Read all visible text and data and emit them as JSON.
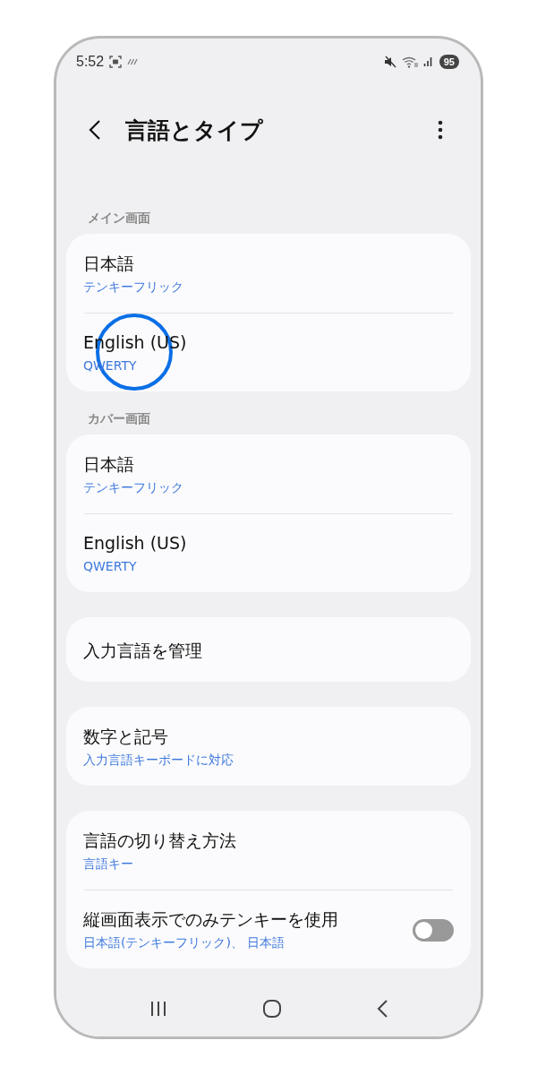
{
  "status_bar": {
    "time": "5:52",
    "battery": "95"
  },
  "header": {
    "title": "言語とタイプ"
  },
  "sections": [
    {
      "header": "メイン画面",
      "items": [
        {
          "kind": "link",
          "title": "日本語",
          "subtitle": "テンキーフリック",
          "touched": false
        },
        {
          "kind": "link",
          "title": "English (US)",
          "subtitle": "QWERTY",
          "touched": true
        }
      ]
    },
    {
      "header": "カバー画面",
      "items": [
        {
          "kind": "link",
          "title": "日本語",
          "subtitle": "テンキーフリック",
          "touched": false
        },
        {
          "kind": "link",
          "title": "English (US)",
          "subtitle": "QWERTY",
          "touched": false
        }
      ]
    },
    {
      "items": [
        {
          "kind": "link",
          "title": "入力言語を管理",
          "touched": false
        }
      ]
    },
    {
      "items": [
        {
          "kind": "link",
          "title": "数字と記号",
          "subtitle": "入力言語キーボードに対応",
          "touched": false
        }
      ]
    },
    {
      "items": [
        {
          "kind": "link",
          "title": "言語の切り替え方法",
          "subtitle": "言語キー",
          "touched": false
        },
        {
          "kind": "switch",
          "title": "縦画面表示でのみテンキーを使用",
          "subtitle": "日本語(テンキーフリック)、 日本語",
          "on": false,
          "touched": false
        }
      ]
    }
  ]
}
